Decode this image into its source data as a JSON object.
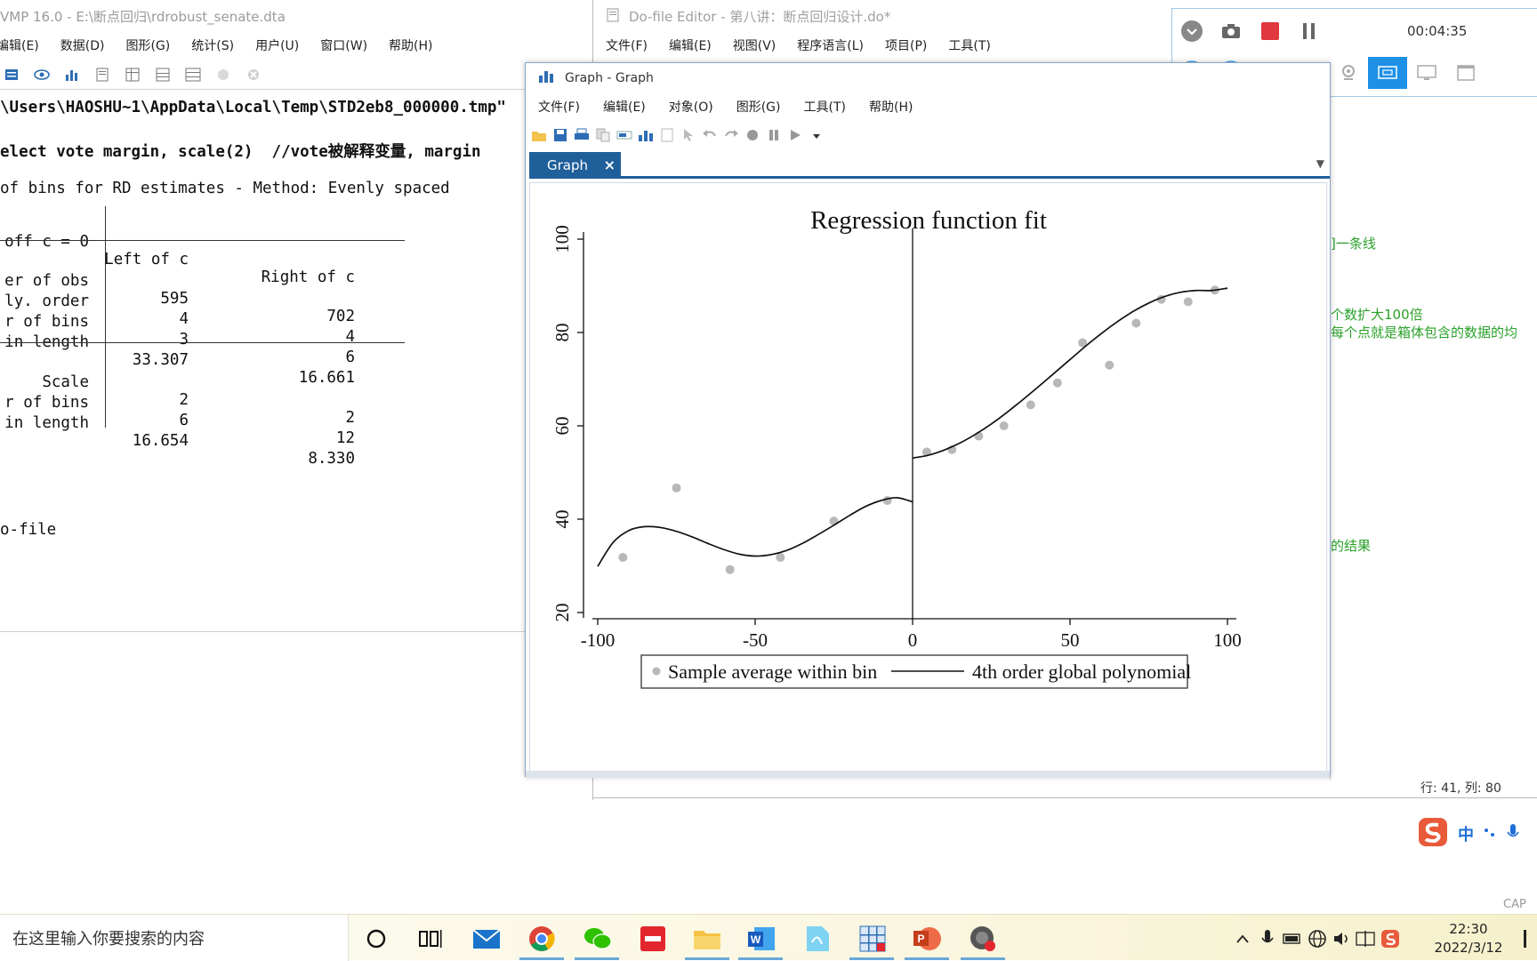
{
  "stata": {
    "title": "VMP 16.0 - E:\\断点回归\\rdrobust_senate.dta",
    "menu": [
      "编辑(E)",
      "数据(D)",
      "图形(G)",
      "统计(S)",
      "用户(U)",
      "窗口(W)",
      "帮助(H)"
    ],
    "results": {
      "path_line": "\\Users\\HAOSHU~1\\AppData\\Local\\Temp\\STD2eb8_000000.tmp\"",
      "cmd_line": "elect vote margin, scale(2)  //vote被解释变量, margin",
      "bins_line": "of bins for RD estimates - Method: Evenly spaced",
      "table": {
        "header": [
          "off c = 0",
          "Left of c",
          "Right of c"
        ],
        "rows1": [
          {
            "label": "er of obs",
            "left": "595",
            "right": "702"
          },
          {
            "label": "ly. order",
            "left": "4",
            "right": "4"
          },
          {
            "label": "r of bins",
            "left": "3",
            "right": "6"
          },
          {
            "label": "in length",
            "left": "33.307",
            "right": "16.661"
          }
        ],
        "rows2": [
          {
            "label": "Scale",
            "left": "2",
            "right": "2"
          },
          {
            "label": "r of bins",
            "left": "6",
            "right": "12"
          },
          {
            "label": "in length",
            "left": "16.654",
            "right": "8.330"
          }
        ]
      },
      "end_line": "o-file"
    }
  },
  "dofile": {
    "title": "Do-file Editor - 第八讲：断点回归设计.do*",
    "menu": [
      "文件(F)",
      "编辑(E)",
      "视图(V)",
      "程序语言(L)",
      "项目(P)",
      "工具(T)"
    ],
    "comments": [
      "]一条线",
      "个数扩大100倍",
      "每个点就是箱体包含的数据的均",
      "的结果"
    ],
    "status": "行: 41, 列: 80"
  },
  "recorder": {
    "time": "00:04:35"
  },
  "graph_window": {
    "title": "Graph - Graph",
    "menu": [
      "文件(F)",
      "编辑(E)",
      "对象(O)",
      "图形(G)",
      "工具(T)",
      "帮助(H)"
    ],
    "tab_label": "Graph",
    "tab_close": "×"
  },
  "chart_data": {
    "type": "scatter",
    "title": "Regression function fit",
    "xlabel": "",
    "ylabel": "",
    "xlim": [
      -100,
      100
    ],
    "ylim": [
      20,
      100
    ],
    "xticks": [
      "-100",
      "-50",
      "0",
      "50",
      "100"
    ],
    "yticks": [
      "20",
      "40",
      "60",
      "80",
      "100"
    ],
    "cutoff": 0,
    "series": [
      {
        "name": "Sample average within bin",
        "kind": "points",
        "x": [
          -92,
          -75,
          -58,
          -42,
          -25,
          -8,
          4.5,
          12.5,
          21,
          29,
          37.5,
          46,
          54,
          62.5,
          71,
          79,
          87.5,
          96
        ],
        "y": [
          31.8,
          46.7,
          29.2,
          31.8,
          39.6,
          44.0,
          54.4,
          54.9,
          57.8,
          60.0,
          64.5,
          69.2,
          77.8,
          73.0,
          82.0,
          87.1,
          86.6,
          89.1
        ]
      },
      {
        "name": "4th order global polynomial",
        "kind": "line",
        "segments": [
          {
            "x": [
              -100,
              -95,
              -90,
              -85,
              -80,
              -75,
              -70,
              -65,
              -60,
              -55,
              -50,
              -45,
              -40,
              -35,
              -30,
              -25,
              -20,
              -15,
              -10,
              -5,
              0
            ],
            "y": [
              29.9,
              35.1,
              37.6,
              38.4,
              38.2,
              37.4,
              36.2,
              34.8,
              33.5,
              32.5,
              32.1,
              32.4,
              33.3,
              34.8,
              36.7,
              38.7,
              40.8,
              42.7,
              44.0,
              44.6,
              43.7
            ]
          },
          {
            "x": [
              0,
              5,
              10,
              15,
              20,
              25,
              30,
              35,
              40,
              45,
              50,
              55,
              60,
              65,
              70,
              75,
              80,
              85,
              90,
              95,
              100
            ],
            "y": [
              53.1,
              53.7,
              54.8,
              56.3,
              58.2,
              60.4,
              62.9,
              65.6,
              68.4,
              71.3,
              74.2,
              77.1,
              79.8,
              82.3,
              84.5,
              86.3,
              87.7,
              88.6,
              89.0,
              89.0,
              89.5
            ]
          }
        ]
      }
    ],
    "legend": {
      "position": "bottom",
      "items": [
        "Sample average within bin",
        "4th order global polynomial"
      ]
    }
  },
  "taskbar": {
    "search_placeholder": "在这里输入你要搜索的内容",
    "time": "22:30",
    "date": "2022/3/12",
    "cap_label": "CAP"
  },
  "ime": {
    "lang": "中"
  },
  "colors": {
    "accent": "#1f5f9a",
    "comment_green": "#2aa12a",
    "record_red": "#e0383e",
    "point_gray": "#b8b8b8"
  }
}
